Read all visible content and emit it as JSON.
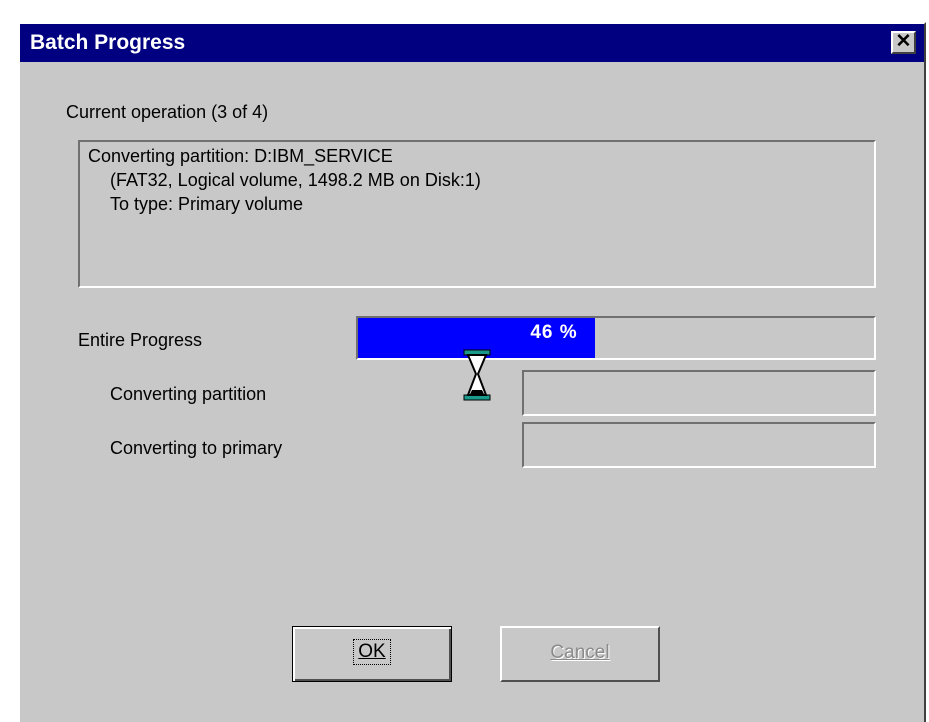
{
  "window": {
    "title": "Batch Progress",
    "close_glyph": "✕"
  },
  "operation": {
    "heading": "Current operation (3 of 4)",
    "details": [
      "Converting partition: D:IBM_SERVICE",
      "(FAT32, Logical volume, 1498.2 MB on Disk:1)",
      "To type: Primary volume"
    ]
  },
  "progress": {
    "entire_label": "Entire Progress",
    "percent": 46,
    "percent_text": "46 %",
    "steps": [
      {
        "label": "Converting partition",
        "progress": 0
      },
      {
        "label": "Converting to primary",
        "progress": 0
      }
    ]
  },
  "buttons": {
    "ok_label": "OK",
    "cancel_label": "Cancel"
  },
  "cursor": {
    "icon": "hourglass-icon"
  },
  "colors": {
    "titlebar": "#000080",
    "progress_fill": "#0000ff",
    "face": "#c8c8c8"
  }
}
